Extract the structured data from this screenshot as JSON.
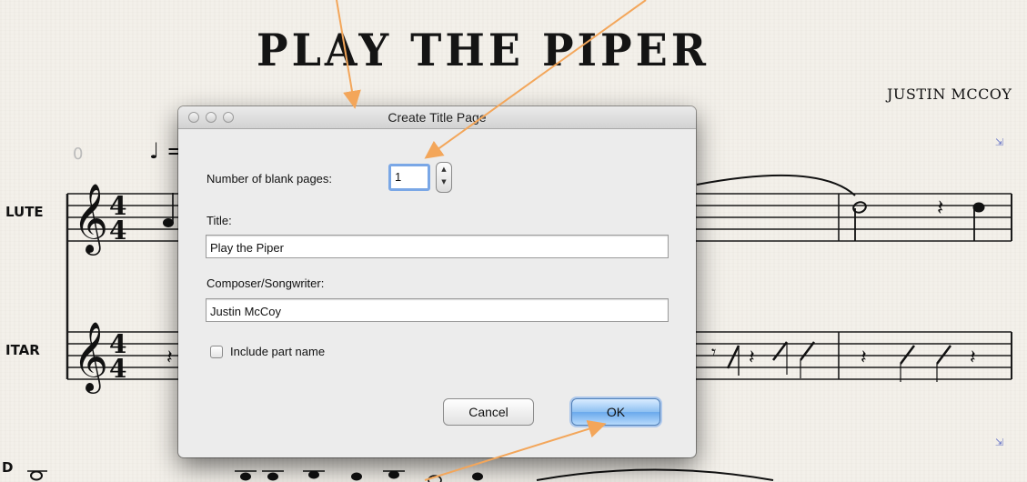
{
  "score": {
    "title": "PLAY THE PIPER",
    "composer": "JUSTIN MCCOY",
    "parts": [
      "LUTE",
      "ITAR",
      "D"
    ],
    "measure_number": "0",
    "tempo_marking": "♩ ="
  },
  "dialog": {
    "title": "Create Title Page",
    "blank_pages_label": "Number of blank pages:",
    "blank_pages_value": "1",
    "title_label": "Title:",
    "title_value": "Play the Piper",
    "composer_label": "Composer/Songwriter:",
    "composer_value": "Justin McCoy",
    "include_part_label": "Include part name",
    "include_part_checked": false,
    "cancel_label": "Cancel",
    "ok_label": "OK"
  },
  "colors": {
    "annotation_arrow": "#f3a65a",
    "ok_button": "#7ab3ee",
    "focus_ring": "#7aa7e6"
  }
}
